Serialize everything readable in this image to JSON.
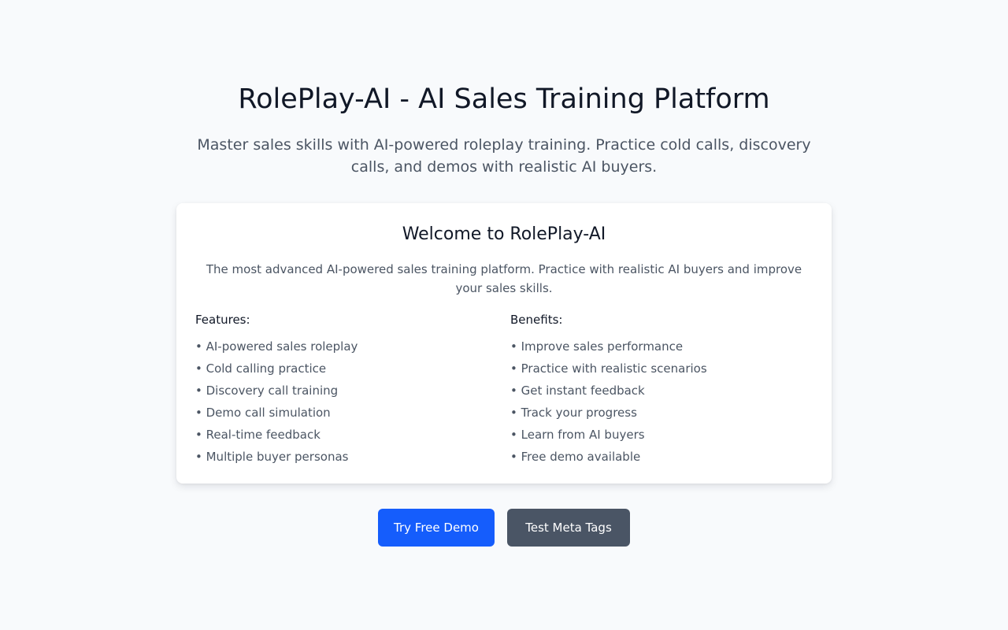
{
  "hero": {
    "title": "RolePlay-AI - AI Sales Training Platform",
    "subtitle": "Master sales skills with AI-powered roleplay training. Practice cold calls, discovery calls, and demos with realistic AI buyers."
  },
  "card": {
    "title": "Welcome to RolePlay-AI",
    "description": "The most advanced AI-powered sales training platform. Practice with realistic AI buyers and improve your sales skills.",
    "features": {
      "heading": "Features:",
      "items": [
        "• AI-powered sales roleplay",
        "• Cold calling practice",
        "• Discovery call training",
        "• Demo call simulation",
        "• Real-time feedback",
        "• Multiple buyer personas"
      ]
    },
    "benefits": {
      "heading": "Benefits:",
      "items": [
        "• Improve sales performance",
        "• Practice with realistic scenarios",
        "• Get instant feedback",
        "• Track your progress",
        "• Learn from AI buyers",
        "• Free demo available"
      ]
    }
  },
  "actions": {
    "primary_label": "Try Free Demo",
    "secondary_label": "Test Meta Tags"
  },
  "colors": {
    "background": "#f8fafc",
    "primary_button": "#155dfc",
    "secondary_button": "#4a5565",
    "heading_text": "#111827",
    "body_text": "#4b5563"
  }
}
